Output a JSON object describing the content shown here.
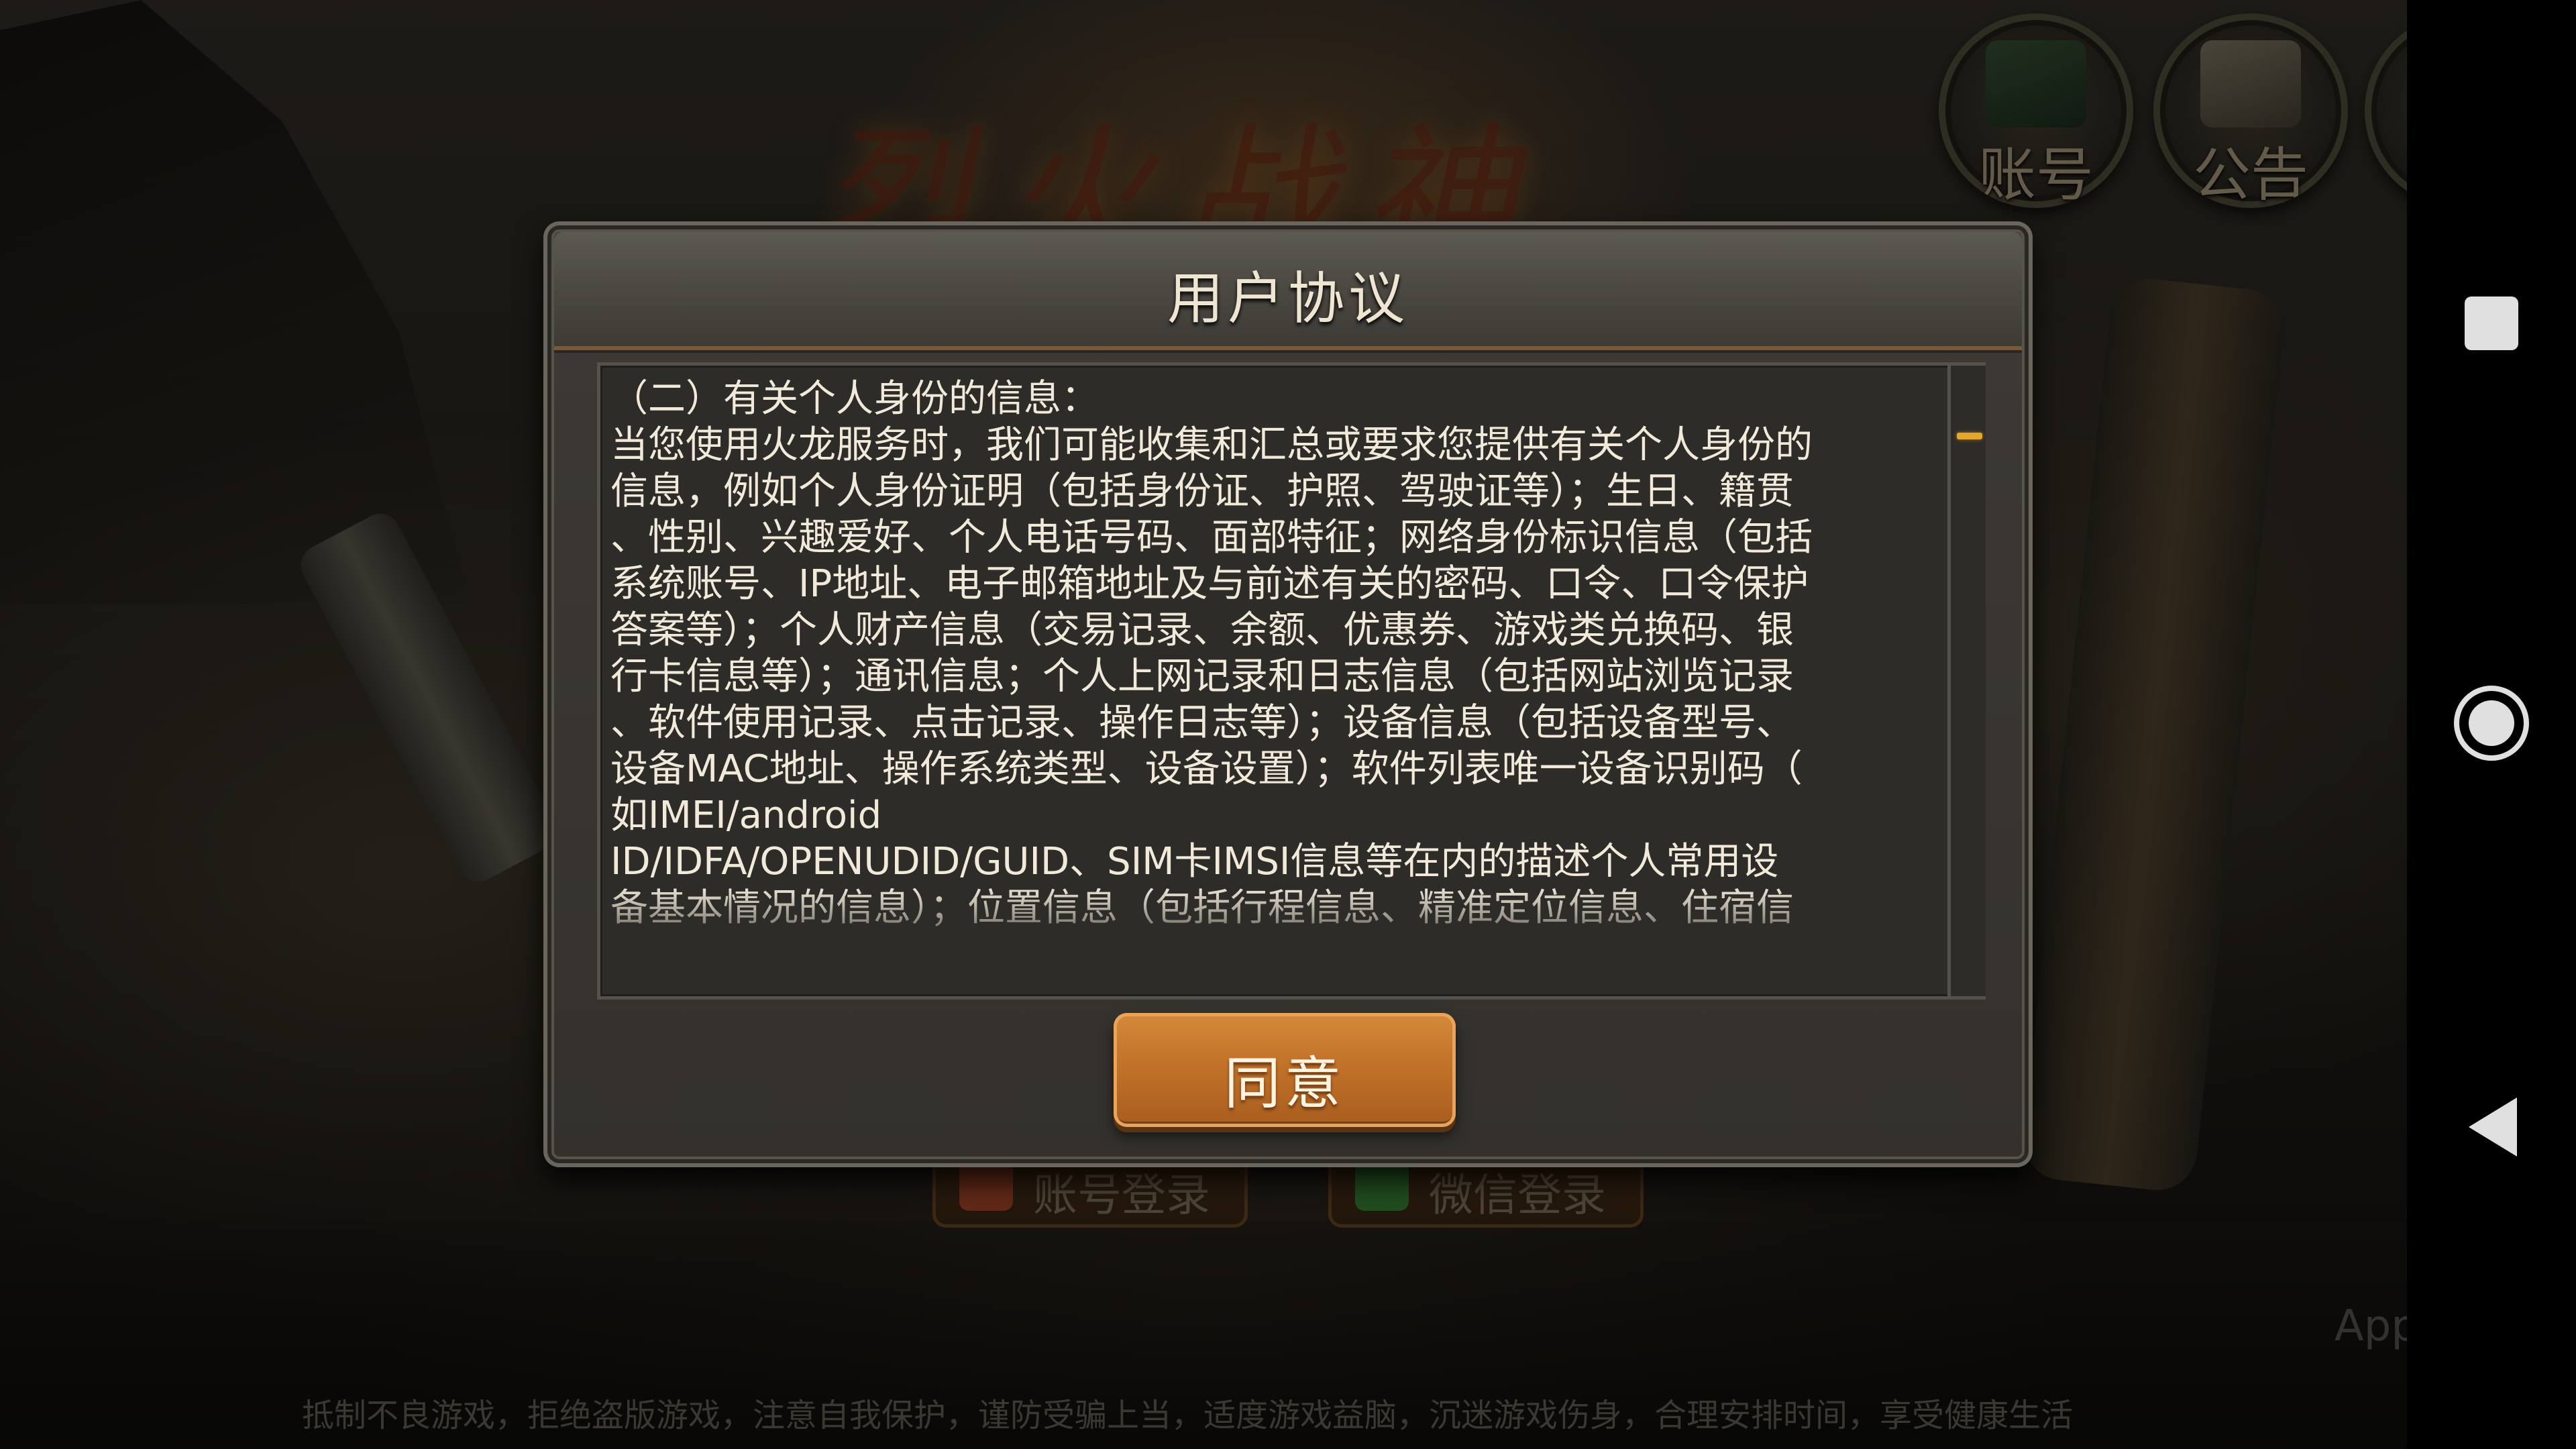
{
  "game": {
    "logo_text": "烈火战神",
    "top_buttons": {
      "account_label": "账号",
      "notice_label": "公告"
    },
    "login_buttons": {
      "account_login_label": "账号登录",
      "wechat_login_label": "微信登录"
    },
    "watermark": "App",
    "health_notice": "抵制不良游戏，拒绝盗版游戏，注意自我保护，谨防受骗上当，适度游戏益脑，沉迷游戏伤身，合理安排时间，享受健康生活"
  },
  "dialog": {
    "title": "用户协议",
    "agreement_text": "（二）有关个人身份的信息：\n当您使用火龙服务时，我们可能收集和汇总或要求您提供有关个人身份的\n信息，例如个人身份证明（包括身份证、护照、驾驶证等）；生日、籍贯\n、性别、兴趣爱好、个人电话号码、面部特征；网络身份标识信息（包括\n系统账号、IP地址、电子邮箱地址及与前述有关的密码、口令、口令保护\n答案等）；个人财产信息（交易记录、余额、优惠券、游戏类兑换码、银\n行卡信息等）；通讯信息；个人上网记录和日志信息（包括网站浏览记录\n、软件使用记录、点击记录、操作日志等）；设备信息（包括设备型号、\n设备MAC地址、操作系统类型、设备设置）；软件列表唯一设备识别码（\n如IMEI/android\nID/IDFA/OPENUDID/GUID、SIM卡IMSI信息等在内的描述个人常用设\n备基本情况的信息）；位置信息（包括行程信息、精准定位信息、住宿信",
    "agree_label": "同意",
    "scroll_position": 0.0
  },
  "colors": {
    "accent_orange": "#c2722a",
    "scroll_thumb": "#e6a62a",
    "text": "#f1eadb"
  },
  "nav_bar": {
    "icons": [
      "recents-icon",
      "home-icon",
      "back-icon"
    ]
  }
}
